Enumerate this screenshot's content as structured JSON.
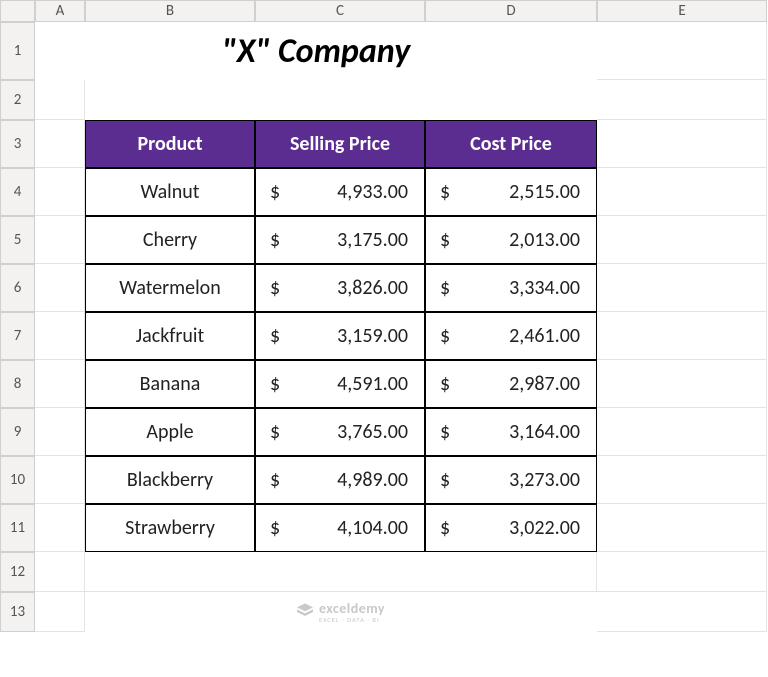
{
  "columns": [
    "A",
    "B",
    "C",
    "D",
    "E"
  ],
  "rows": [
    "1",
    "2",
    "3",
    "4",
    "5",
    "6",
    "7",
    "8",
    "9",
    "10",
    "11",
    "12",
    "13"
  ],
  "title": "\"X\" Company",
  "headers": {
    "product": "Product",
    "selling": "Selling Price",
    "cost": "Cost Price"
  },
  "currency": "$",
  "data": [
    {
      "product": "Walnut",
      "selling": "4,933.00",
      "cost": "2,515.00"
    },
    {
      "product": "Cherry",
      "selling": "3,175.00",
      "cost": "2,013.00"
    },
    {
      "product": "Watermelon",
      "selling": "3,826.00",
      "cost": "3,334.00"
    },
    {
      "product": "Jackfruit",
      "selling": "3,159.00",
      "cost": "2,461.00"
    },
    {
      "product": "Banana",
      "selling": "4,591.00",
      "cost": "2,987.00"
    },
    {
      "product": "Apple",
      "selling": "3,765.00",
      "cost": "3,164.00"
    },
    {
      "product": "Blackberry",
      "selling": "4,989.00",
      "cost": "3,273.00"
    },
    {
      "product": "Strawberry",
      "selling": "4,104.00",
      "cost": "3,022.00"
    }
  ],
  "watermark": {
    "name": "exceldemy",
    "tag": "EXCEL · DATA · BI"
  }
}
